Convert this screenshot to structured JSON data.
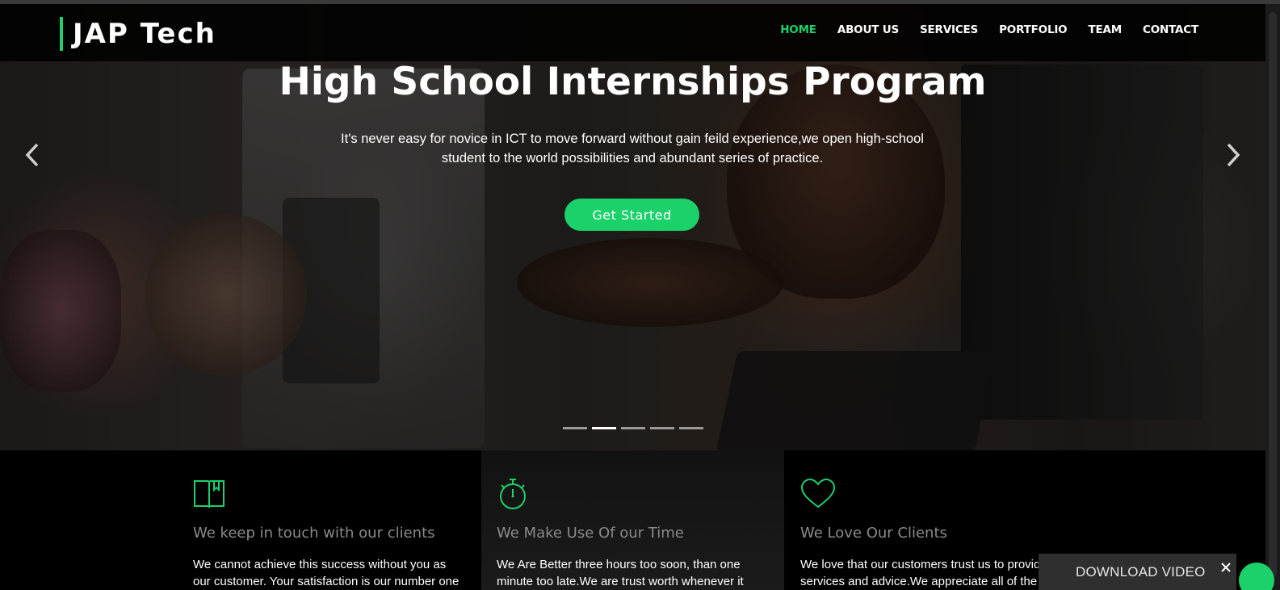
{
  "brand": {
    "logo_text": "JAP Tech",
    "accent_color": "#1bd16a"
  },
  "nav": {
    "items": [
      {
        "label": "HOME",
        "active": true
      },
      {
        "label": "ABOUT US",
        "active": false
      },
      {
        "label": "SERVICES",
        "active": false
      },
      {
        "label": "PORTFOLIO",
        "active": false
      },
      {
        "label": "TEAM",
        "active": false
      },
      {
        "label": "CONTACT",
        "active": false
      }
    ]
  },
  "hero": {
    "title": "High School Internships Program",
    "text": "It's never easy for novice in ICT to move forward without gain feild experience,we open high-school student to the world possibilities and abundant series of practice.",
    "cta_label": "Get Started",
    "prev_icon": "chevron-left-icon",
    "next_icon": "chevron-right-icon",
    "slides_count": 5,
    "active_slide": 2
  },
  "features": [
    {
      "icon": "book-icon",
      "title": "We keep in touch with our clients",
      "text": "We cannot achieve this success without you as our customer. Your satisfaction is our number one"
    },
    {
      "icon": "stopwatch-icon",
      "title": "We Make Use Of our Time",
      "text": "We Are Better three hours too soon, than one minute too late.We are trust worth whenever it"
    },
    {
      "icon": "heart-icon",
      "title": "We Love Our Clients",
      "text": "We love that our customers trust us to provide services and advice.We appreciate all of the positive"
    }
  ],
  "download_popup": {
    "label": "DOWNLOAD VIDEO",
    "close_icon": "close-icon"
  }
}
